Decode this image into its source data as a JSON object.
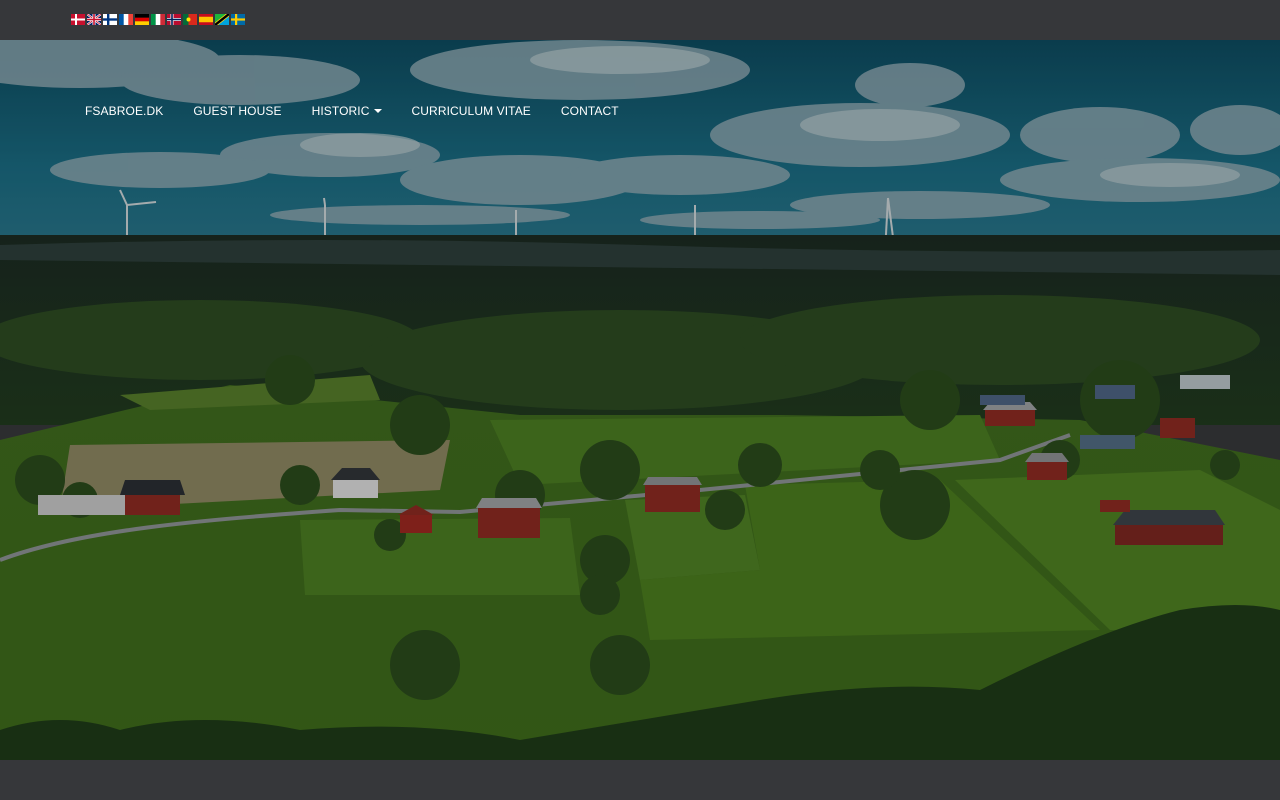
{
  "languages": [
    {
      "code": "da",
      "icon": "flag-denmark-icon"
    },
    {
      "code": "en",
      "icon": "flag-uk-icon"
    },
    {
      "code": "fi",
      "icon": "flag-finland-icon"
    },
    {
      "code": "fr",
      "icon": "flag-france-icon"
    },
    {
      "code": "de",
      "icon": "flag-germany-icon"
    },
    {
      "code": "it",
      "icon": "flag-italy-icon"
    },
    {
      "code": "no",
      "icon": "flag-norway-icon"
    },
    {
      "code": "pt",
      "icon": "flag-portugal-icon"
    },
    {
      "code": "es",
      "icon": "flag-spain-icon"
    },
    {
      "code": "tz",
      "icon": "flag-tanzania-icon"
    },
    {
      "code": "sv",
      "icon": "flag-sweden-icon"
    }
  ],
  "nav": {
    "home": "FSABROE.DK",
    "guest_house": "GUEST HOUSE",
    "historic": "HISTORIC",
    "curriculum_vitae": "CURRICULUM VITAE",
    "contact": "CONTACT"
  },
  "colors": {
    "bar": "#36373a",
    "nav_text": "#ffffff"
  }
}
